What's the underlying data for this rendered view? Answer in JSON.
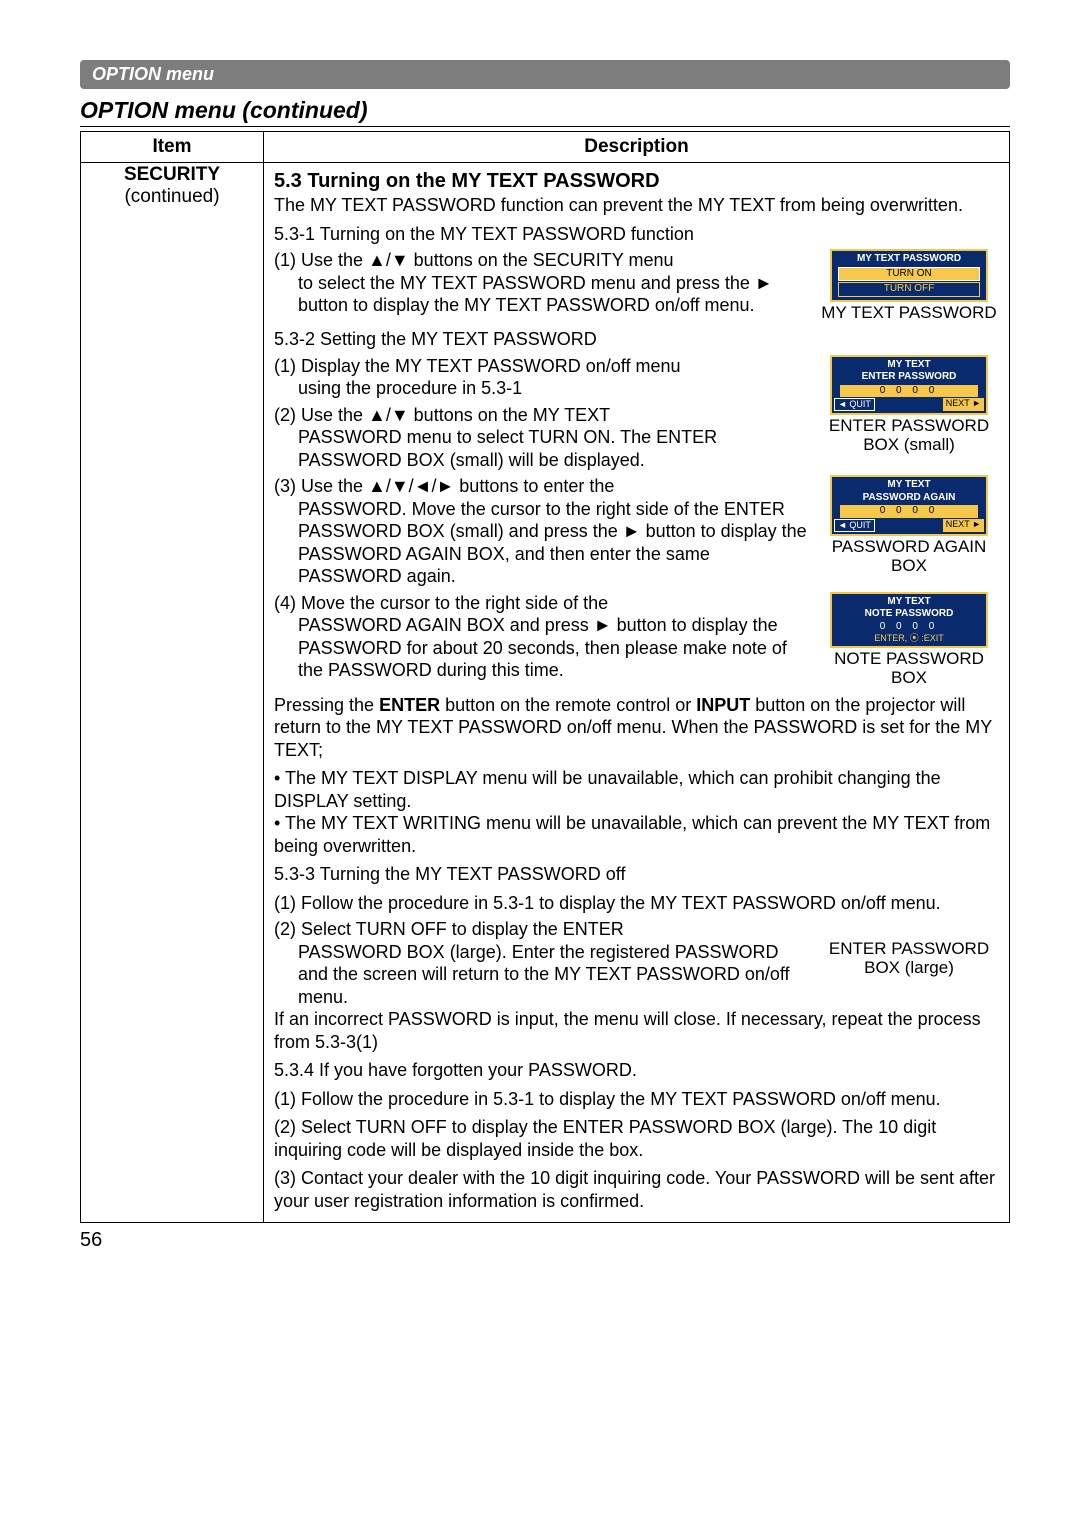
{
  "banner": "OPTION menu",
  "section_title": "OPTION menu (continued)",
  "header_item": "Item",
  "header_desc": "Description",
  "item": {
    "name": "SECURITY",
    "cont": "(continued)"
  },
  "desc": {
    "title": "5.3 Turning on the MY TEXT PASSWORD",
    "intro": "The MY TEXT PASSWORD function can prevent the MY TEXT from being overwritten.",
    "s531": "5.3-1 Turning on the MY TEXT PASSWORD function",
    "s531_1a": "(1) Use the ▲/▼ buttons on the SECURITY menu",
    "s531_1b": "to select the MY TEXT PASSWORD menu and press the ► button to display the MY TEXT PASSWORD on/off menu.",
    "fig1_cap": "MY TEXT PASSWORD",
    "s532": "5.3-2 Setting the MY TEXT PASSWORD",
    "s532_1a": "(1) Display the MY TEXT PASSWORD on/off menu",
    "s532_1b": "using the procedure in 5.3-1",
    "s532_2a": "(2) Use the ▲/▼ buttons on the MY TEXT",
    "s532_2b": "PASSWORD menu to select TURN ON. The ENTER PASSWORD BOX (small) will be displayed.",
    "fig2_cap": "ENTER PASSWORD BOX (small)",
    "s532_3a": "(3) Use the ▲/▼/◄/► buttons to enter the",
    "s532_3b": "PASSWORD. Move the cursor to the right side of the ENTER PASSWORD BOX (small) and press the ► button to display the PASSWORD AGAIN BOX, and then enter the same PASSWORD again.",
    "fig3_cap": "PASSWORD AGAIN BOX",
    "s532_4a": "(4) Move the cursor to the right side of the",
    "s532_4b": "PASSWORD AGAIN BOX and press ► button to display the PASSWORD for about 20 seconds, then please make note of the PASSWORD during this time.",
    "fig4_cap": "NOTE PASSWORD BOX",
    "para_enter1": "Pressing the ",
    "para_enter_b1": "ENTER",
    "para_enter2": " button on the remote control or ",
    "para_enter_b2": "INPUT",
    "para_enter3": " button on the projector will return to the MY TEXT PASSWORD on/off menu. When the PASSWORD is set for the MY TEXT;",
    "bullet1": "• The MY TEXT DISPLAY menu will be unavailable, which can prohibit changing the DISPLAY setting.",
    "bullet2": "• The MY TEXT WRITING menu will be unavailable, which can prevent the MY TEXT from being overwritten.",
    "s533": "5.3-3 Turning the MY TEXT PASSWORD off",
    "s533_1": "(1) Follow the procedure in 5.3-1 to display the MY TEXT PASSWORD on/off menu.",
    "s533_2a": "(2) Select TURN OFF to display the ENTER",
    "s533_2b": "PASSWORD BOX (large). Enter the registered PASSWORD and the screen will return to the MY TEXT PASSWORD on/off menu.",
    "fig5_cap": "ENTER PASSWORD BOX (large)",
    "s533_2c": "If an incorrect PASSWORD is input, the menu will close. If necessary, repeat the process from 5.3-3(1)",
    "s534": "5.3.4 If you have forgotten your PASSWORD.",
    "s534_1": "(1) Follow the procedure in 5.3-1 to display the MY TEXT PASSWORD on/off menu.",
    "s534_2": "(2) Select TURN OFF to display the ENTER PASSWORD BOX (large). The 10 digit inquiring code will be displayed inside the box.",
    "s534_3": "(3) Contact your dealer with the 10 digit inquiring code. Your PASSWORD will be sent after your user registration information is confirmed."
  },
  "osd": {
    "fig1_title": "MY TEXT PASSWORD",
    "turn_on": "TURN ON",
    "turn_off": "TURN OFF",
    "fig2_title": "MY TEXT",
    "enter_password": "ENTER PASSWORD",
    "digits": "0 0 0 0",
    "quit": "◄ QUIT",
    "next": "NEXT ►",
    "fig3_title": "MY TEXT",
    "password_again": "PASSWORD AGAIN",
    "fig4_title": "MY TEXT",
    "note_password": "NOTE PASSWORD",
    "note_digits": "0 0 0 0",
    "exit": "ENTER, ⦿ :EXIT"
  },
  "page_num": "56"
}
